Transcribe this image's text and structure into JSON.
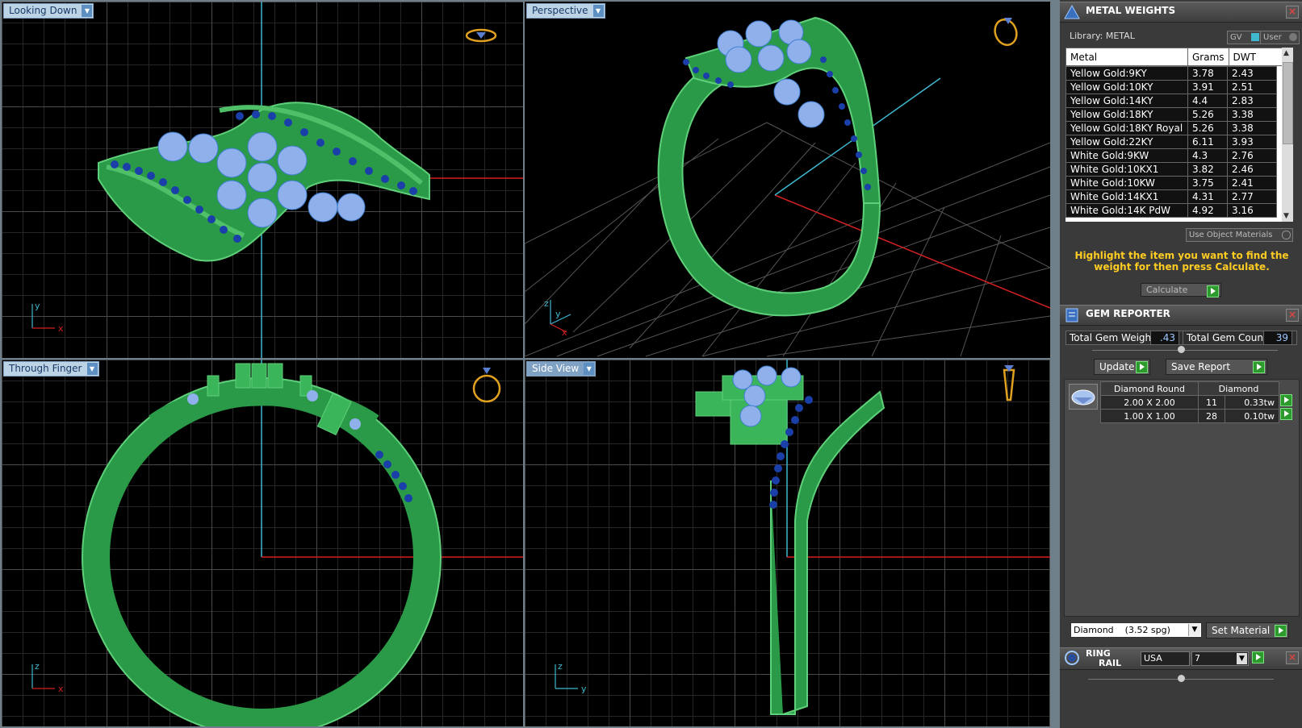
{
  "viewports": {
    "top_left": {
      "label": "Looking Down",
      "axis1": "y",
      "axis2": "x"
    },
    "top_right": {
      "label": "Perspective",
      "axis1": "z",
      "axis2": "y",
      "axis3": "x"
    },
    "bottom_left": {
      "label": "Through Finger",
      "axis1": "z",
      "axis2": "x"
    },
    "bottom_right": {
      "label": "Side View",
      "axis1": "z",
      "axis2": "y"
    }
  },
  "metal_weights": {
    "title": "METAL WEIGHTS",
    "library_label": "Library: METAL",
    "toggle_gv": "GV",
    "toggle_user": "User",
    "columns": [
      "Metal",
      "Grams",
      "DWT"
    ],
    "rows": [
      {
        "metal": "Yellow Gold:9KY",
        "grams": "3.78",
        "dwt": "2.43"
      },
      {
        "metal": "Yellow Gold:10KY",
        "grams": "3.91",
        "dwt": "2.51"
      },
      {
        "metal": "Yellow Gold:14KY",
        "grams": "4.4",
        "dwt": "2.83"
      },
      {
        "metal": "Yellow Gold:18KY",
        "grams": "5.26",
        "dwt": "3.38"
      },
      {
        "metal": "Yellow Gold:18KY Royal",
        "grams": "5.26",
        "dwt": "3.38"
      },
      {
        "metal": "Yellow Gold:22KY",
        "grams": "6.11",
        "dwt": "3.93"
      },
      {
        "metal": "White Gold:9KW",
        "grams": "4.3",
        "dwt": "2.76"
      },
      {
        "metal": "White Gold:10KX1",
        "grams": "3.82",
        "dwt": "2.46"
      },
      {
        "metal": "White Gold:10KW",
        "grams": "3.75",
        "dwt": "2.41"
      },
      {
        "metal": "White Gold:14KX1",
        "grams": "4.31",
        "dwt": "2.77"
      },
      {
        "metal": "White Gold:14K PdW",
        "grams": "4.92",
        "dwt": "3.16"
      }
    ],
    "use_object_materials": "Use Object Materials",
    "hint": "Highlight the item you want to find the weight for then press Calculate.",
    "calculate_label": "Calculate"
  },
  "gem_reporter": {
    "title": "GEM REPORTER",
    "total_weight_label": "Total Gem Weight",
    "total_weight_value": ".43",
    "total_count_label": "Total Gem Count",
    "total_count_value": "39",
    "update_label": "Update",
    "save_report_label": "Save Report",
    "gem_header_shape": "Diamond Round",
    "gem_header_type": "Diamond",
    "gems": [
      {
        "size": "2.00 X 2.00",
        "count": "11",
        "tw": "0.33tw"
      },
      {
        "size": "1.00 X 1.00",
        "count": "28",
        "tw": "0.10tw"
      }
    ],
    "material_select": "Diamond    (3.52 spg)",
    "set_material_label": "Set Material"
  },
  "ring_rail": {
    "title_line1": "RING",
    "title_line2": "RAIL",
    "standard": "USA",
    "size": "7"
  },
  "colors": {
    "metal": "#2fa84f",
    "gem_light": "#8fb0ea",
    "gem_dark": "#1a3fa8",
    "axis_red": "#d42020",
    "axis_cyan": "#3fb8d0",
    "hint": "#ffcc22"
  }
}
